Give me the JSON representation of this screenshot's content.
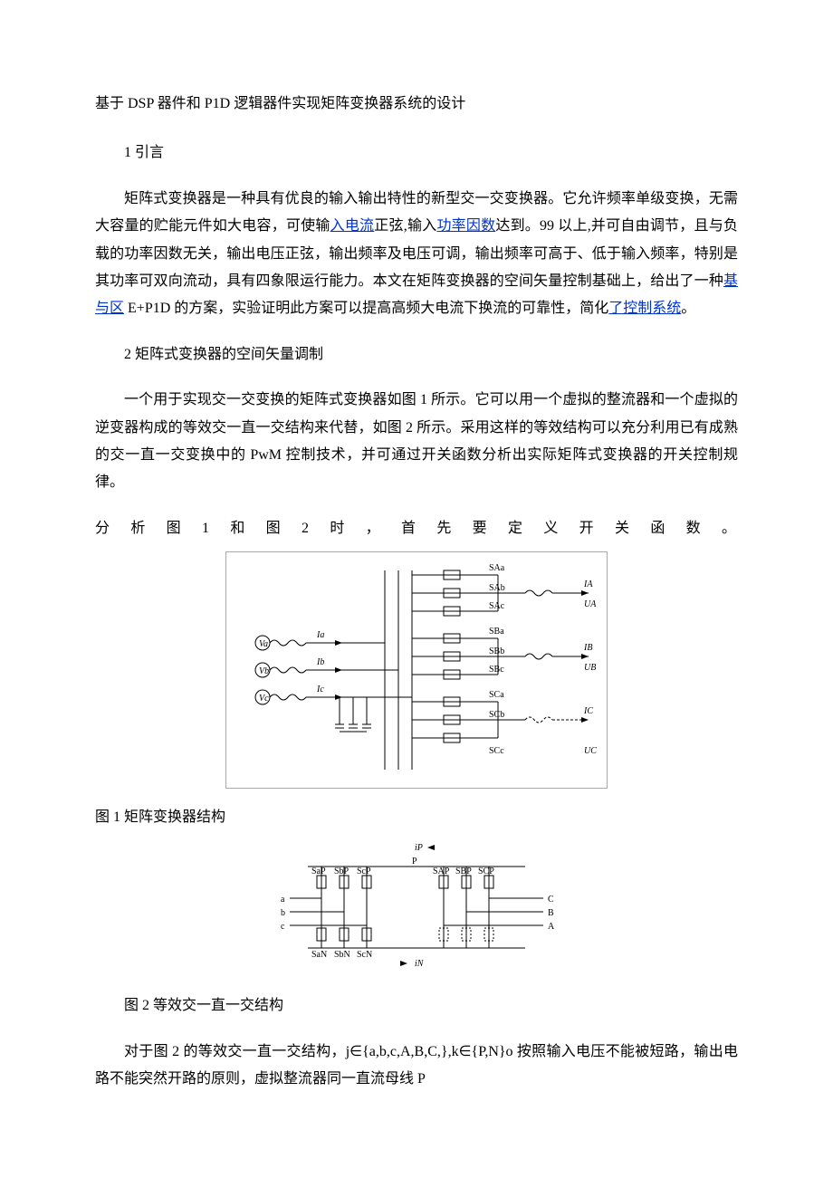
{
  "title": "基于 DSP 器件和 P1D 逻辑器件实现矩阵变换器系统的设计",
  "section1": "1 引言",
  "para1a": "矩阵式变换器是一种具有优良的输入输出特性的新型交一交变换器。它允许频率单级变换，无需大容量的贮能元件如大电容，可使输",
  "link1": "入电流",
  "para1b": "正弦,输入",
  "link2": "功率因数",
  "para1c": "达到。99 以上,并可自由调节，且与负载的功率因数无关，输出电压正弦，输出频率及电压可调，输出频率可高于、低于输入频率，特别是其功率可双向流动，具有四象限运行能力。本文在矩阵变换器的空间矢量控制基础上，给出了一种",
  "link3": "基与区",
  "para1d": " E+P1D 的方案，实验证明此方案可以提高高频大电流下换流的可靠性，简化",
  "link4": "了控制系统",
  "para1e": "。",
  "section2": "2 矩阵式变换器的空间矢量调制",
  "para2": "一个用于实现交一交变换的矩阵式变换器如图 1 所示。它可以用一个虚拟的整流器和一个虚拟的逆变器构成的等效交一直一交结构来代替，如图 2 所示。采用这样的等效结构可以充分利用已有成熟的交一直一交变换中的 PwM 控制技术，并可通过开关函数分析出实际矩阵式变换器的开关控制规律。",
  "spread_line": "分析图1和图2时，首先要定义开关函数。",
  "fig1_caption": "图 1 矩阵变换器结构",
  "fig2_caption": "图 2 等效交一直一交结构",
  "para3": "对于图 2 的等效交一直一交结构，j∈{a,b,c,A,B,C,},k∈{P,N}o 按照输入电压不能被短路，输出电路不能突然开路的原则，虚拟整流器同一直流母线 P",
  "fig1": {
    "inputs": [
      "Va",
      "Vb",
      "Vc"
    ],
    "in_currents": [
      "Ia",
      "Ib",
      "Ic"
    ],
    "switches_A": [
      "SAa",
      "SAb",
      "SAc"
    ],
    "switches_B": [
      "SBa",
      "SBb",
      "SBc"
    ],
    "switches_C": [
      "SCa",
      "SCb",
      "SCc"
    ],
    "out_I": [
      "IA",
      "IB",
      "IC"
    ],
    "out_U": [
      "UA",
      "UB",
      "UC"
    ]
  },
  "fig2": {
    "top_label": "iP",
    "node": "P",
    "left_switches": [
      "SaP",
      "SbP",
      "ScP"
    ],
    "right_switches": [
      "SAP",
      "SBP",
      "SCP"
    ],
    "left_in": [
      "a",
      "b",
      "c"
    ],
    "right_out": [
      "C",
      "B",
      "A"
    ],
    "bottom_left": [
      "SaN",
      "SbN",
      "ScN"
    ],
    "bottom_arrow": "iN"
  }
}
